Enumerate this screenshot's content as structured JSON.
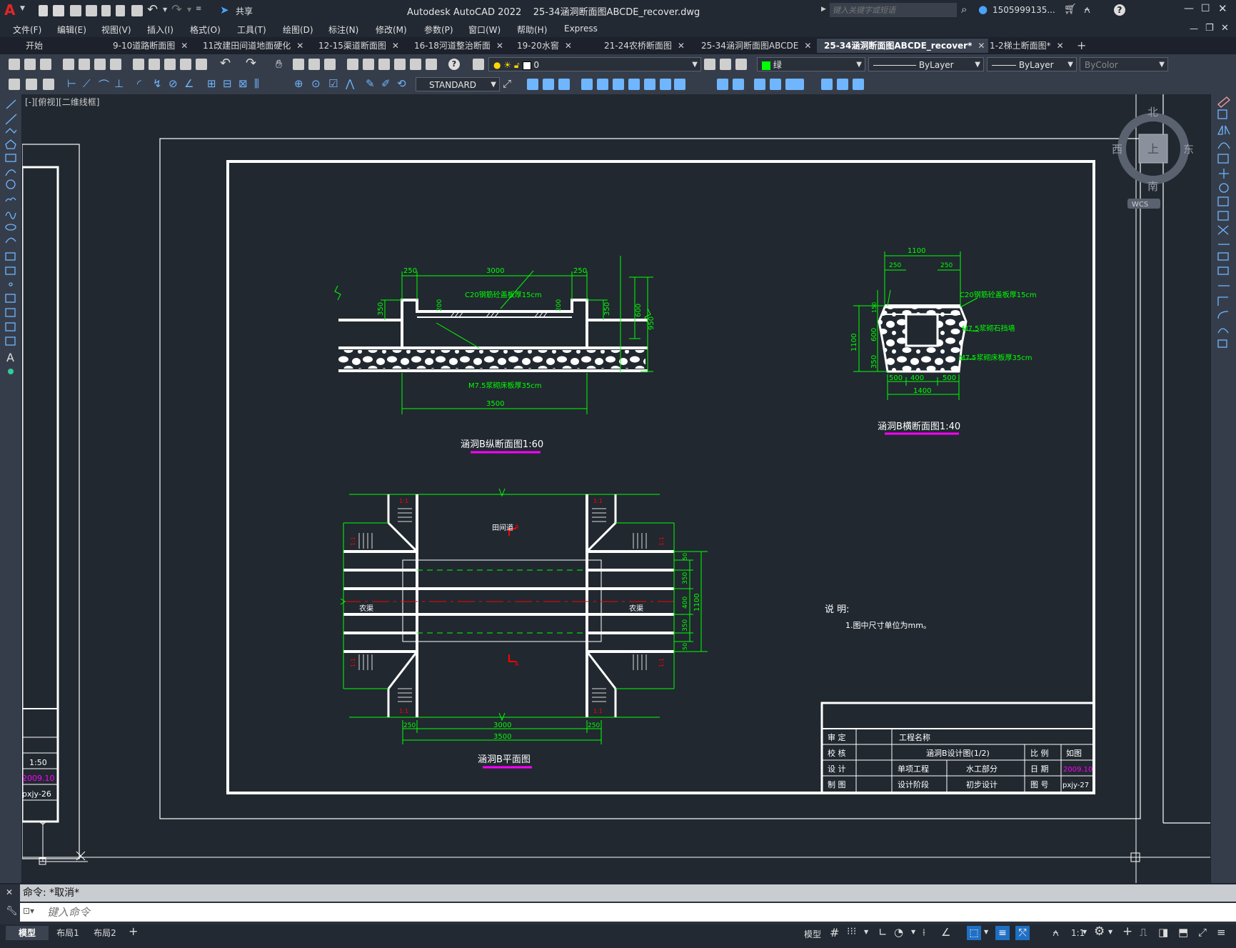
{
  "title": {
    "app": "Autodesk AutoCAD 2022",
    "file": "25-34涵洞断面图ABCDE_recover.dwg",
    "share": "共享",
    "search_placeholder": "键入关键字或短语",
    "user": "1505999135...",
    "help": "?"
  },
  "menu": [
    "文件(F)",
    "编辑(E)",
    "视图(V)",
    "插入(I)",
    "格式(O)",
    "工具(T)",
    "绘图(D)",
    "标注(N)",
    "修改(M)",
    "参数(P)",
    "窗口(W)",
    "帮助(H)",
    "Express"
  ],
  "tabs": [
    {
      "label": "开始",
      "close": ""
    },
    {
      "label": "9-10道路断面图",
      "close": "✕"
    },
    {
      "label": "11改建田间道地面硬化",
      "close": "✕"
    },
    {
      "label": "12-15渠道断面图",
      "close": "✕"
    },
    {
      "label": "16-18河道整治断面",
      "close": "✕"
    },
    {
      "label": "19-20水窖",
      "close": "✕"
    },
    {
      "label": "21-24农桥断面图",
      "close": "✕"
    },
    {
      "label": "25-34涵洞断面图ABCDE",
      "close": "✕"
    },
    {
      "label": "25-34涵洞断面图ABCDE_recover*",
      "close": "✕"
    },
    {
      "label": "1-2梯土断面图*",
      "close": "✕"
    }
  ],
  "toolbar": {
    "layer": "0",
    "color": "绿",
    "linetype": "ByLayer",
    "lineweight": "ByLayer",
    "plotstyle": "ByColor",
    "textstyle": "STANDARD"
  },
  "colors": {
    "accent": "#00ff00",
    "pink": "#ff00ff",
    "red": "#ff0000",
    "white": "#ffffff"
  },
  "viewport_label": "[-][俯视][二维线框]",
  "viewcube": {
    "n": "北",
    "s": "南",
    "e": "东",
    "w": "西",
    "top": "上",
    "wcs": "WCS"
  },
  "drawing": {
    "profile": {
      "title": "涵洞B纵断面图1:60",
      "cover_label": "C20钢筋砼盖板厚15cm",
      "bed_label": "M7.5浆砌床板厚35cm",
      "dims": {
        "top_left": "250",
        "top_mid": "3000",
        "top_right": "250",
        "bottom": "3500",
        "left_h": "350",
        "right_h1": "350",
        "r600": "600",
        "r950": "950",
        "c200a": "200",
        "c200b": "200"
      }
    },
    "cross": {
      "title": "涵洞B横断面图1:40",
      "cover_label": "C20钢筋砼盖板厚15cm",
      "wall_label": "M7.5浆砌石挡墙",
      "bed_label": "M7.5浆砌床板厚35cm",
      "dims": {
        "top": "1100",
        "t250a": "250",
        "t250b": "250",
        "h1100": "1100",
        "h150": "150",
        "h600": "600",
        "h350": "350",
        "b500a": "500",
        "b400": "400",
        "b500b": "500",
        "b1400": "1400"
      }
    },
    "plan": {
      "title": "涵洞B平面图",
      "road_label": "田间道",
      "canal_left": "农渠",
      "canal_right": "农渠",
      "section_a": "A",
      "slope": "1:1",
      "dims": {
        "b250a": "250",
        "b3000": "3000",
        "b250b": "250",
        "b3500": "3500",
        "r50a": "50",
        "r350a": "350",
        "r400": "400",
        "r1100": "1100",
        "r350b": "350",
        "r50b": "50"
      }
    },
    "notes": {
      "heading": "说 明:",
      "line1": "1.图中尺寸单位为mm。"
    },
    "titleblock": {
      "r1c1": "审 定",
      "r1c3": "工程名称",
      "r2c1": "校 核",
      "r2c3": "涵洞B设计图(1/2)",
      "r2c5": "比 例",
      "r2c6": "如图",
      "r3c1": "设 计",
      "r3c3": "单项工程",
      "r3c4": "水工部分",
      "r3c5": "日 期",
      "r3c6": "2009.10",
      "r4c1": "制 图",
      "r4c3": "设计阶段",
      "r4c4": "初步设计",
      "r4c5": "图 号",
      "r4c6": "pxjy-27"
    },
    "left_sheet": {
      "scale": "1:50",
      "date": "2009.10",
      "num": "pxjy-26"
    }
  },
  "command": {
    "history": "命令: *取消*",
    "placeholder": "键入命令"
  },
  "status": {
    "layouts": [
      "模型",
      "布局1",
      "布局2"
    ],
    "add": "+",
    "model": "模型",
    "scale": "1:1"
  }
}
